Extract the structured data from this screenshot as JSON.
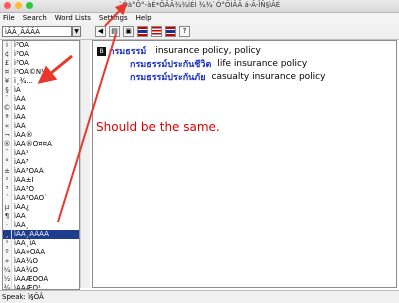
{
  "window": {
    "title": "`Óà°Õ°-àÈ*ÕÂÃ¾¾ÌÉÌ ¾¾`Ó°ÕÌÂÃ á-Ã-ÎÑ§ìÂÉ",
    "traffic_lights": [
      "#ff5f57",
      "#febc2e",
      "#28c840"
    ]
  },
  "menu": [
    "File",
    "Search",
    "Word Lists",
    "Settings",
    "Help"
  ],
  "toolbar": {
    "search_value": "ìÂÃ¸ÃÄÃÁ",
    "dropdown_icon": "chevron-down-icon",
    "icons": [
      "back-icon",
      "print-icon",
      "save-icon",
      "thai-flag-icon",
      "us-flag-icon",
      "thai-flag-icon",
      "help-icon"
    ]
  },
  "word_list": [
    {
      "gutter": "i",
      "text": "ì³ÕÃ",
      "selected": false
    },
    {
      "gutter": "¢",
      "text": "ì³ÕÃ",
      "selected": false
    },
    {
      "gutter": "£",
      "text": "ì³ÕÃ",
      "selected": false
    },
    {
      "gutter": "¤",
      "text": "ì³ÕÂ©Ñ¹",
      "selected": false
    },
    {
      "gutter": "¥",
      "text": "ì¸¾...",
      "selected": false
    },
    {
      "gutter": "§",
      "text": "ìÁ",
      "selected": false
    },
    {
      "gutter": "¨",
      "text": "ìÁÁ",
      "selected": false
    },
    {
      "gutter": "©",
      "text": "ìÁÃ",
      "selected": false
    },
    {
      "gutter": "ª",
      "text": "ìÂÃ",
      "selected": false
    },
    {
      "gutter": "«",
      "text": "ìÂÂ",
      "selected": false
    },
    {
      "gutter": "¬",
      "text": "ìÂÃ®",
      "selected": false
    },
    {
      "gutter": "®",
      "text": "ìÂÃ®Õ¤¤Ã",
      "selected": false
    },
    {
      "gutter": "¯",
      "text": "ìÂÃ¹",
      "selected": false
    },
    {
      "gutter": "°",
      "text": "ìÂÃ³",
      "selected": false
    },
    {
      "gutter": "±",
      "text": "ìÂÃ³ÕÃÂ",
      "selected": false
    },
    {
      "gutter": "²",
      "text": "ìÂÃ±Ì",
      "selected": false
    },
    {
      "gutter": "³",
      "text": "ìÂÃ³Õ",
      "selected": false
    },
    {
      "gutter": "´",
      "text": "ìÂÃ³ÕÂÕ`",
      "selected": false
    },
    {
      "gutter": "µ",
      "text": "ìÂÃ¿",
      "selected": false
    },
    {
      "gutter": "¶",
      "text": "ìÂÃ",
      "selected": false
    },
    {
      "gutter": "·",
      "text": "ìÂÃ¸",
      "selected": false
    },
    {
      "gutter": "¸",
      "text": "ìÂÃ¸ÃÄÃÁ",
      "selected": true
    },
    {
      "gutter": "¹",
      "text": "ìÂÃ¸ìÃ",
      "selected": false
    },
    {
      "gutter": "º",
      "text": "ìÂÃ»ÕÂÃ",
      "selected": false
    },
    {
      "gutter": "»",
      "text": "ìÂÃ¾Õ",
      "selected": false
    },
    {
      "gutter": "¼",
      "text": "ìÂÃ¾Õ",
      "selected": false
    },
    {
      "gutter": "½",
      "text": "ìÂÃÆÒÕÂ",
      "selected": false
    },
    {
      "gutter": "¾",
      "text": "ìÂÃÆÒ¹",
      "selected": false
    }
  ],
  "entry": {
    "head_icon": "dictionary-icon",
    "headword": "กรมธรรม์",
    "definition": "insurance policy, policy",
    "subentries": [
      {
        "thai": "กรมธรรม์ประกันชีวิต",
        "english": "life insurance policy"
      },
      {
        "thai": "กรมธรรม์ประกันภัย",
        "english": "casualty insurance policy"
      }
    ]
  },
  "annotation": "Should  be the same.",
  "status": "Speak: ì§ÕÂ",
  "colors": {
    "accent": "#1f3d8f",
    "thai_text": "#1a2fbf",
    "annotation": "#e00000"
  }
}
